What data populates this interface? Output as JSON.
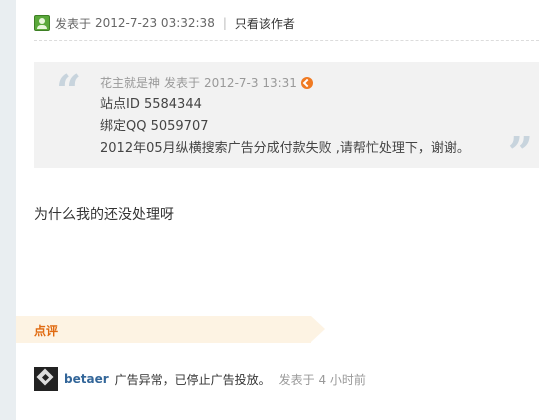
{
  "post": {
    "meta_prefix": "发表于",
    "date": "2012-7-23 03:32:38",
    "only_author": "只看该作者"
  },
  "quote": {
    "author": "花主就是神",
    "meta_prefix": "发表于",
    "date": "2012-7-3 13:31",
    "lines": [
      "站点ID 5584344",
      "绑定QQ 5059707",
      "2012年05月纵横搜索广告分成付款失败 ,请帮忙处理下，谢谢。"
    ]
  },
  "reply_text": "为什么我的还没处理呀",
  "comments": {
    "title": "点评",
    "items": [
      {
        "author": "betaer",
        "text": "广告异常，已停止广告投放。",
        "time": "发表于 4 小时前"
      }
    ]
  },
  "colors": {
    "accent_orange": "#e06a10",
    "link_blue": "#336699",
    "online_green": "#5aa83a"
  },
  "icons": {
    "status": "online-user-icon",
    "jump": "jump-to-post-icon",
    "quote_open": "open-quote-icon",
    "quote_close": "close-quote-icon"
  }
}
